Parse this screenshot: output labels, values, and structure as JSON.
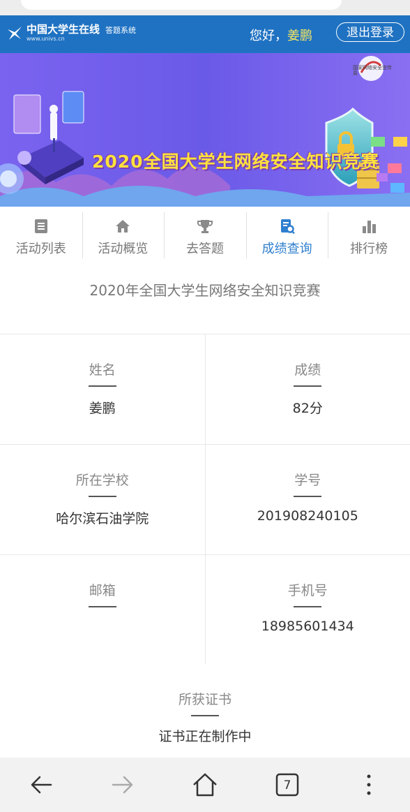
{
  "header": {
    "logo_main": "中国大学生在线",
    "logo_url": "www.univs.cn",
    "logo_sub": "答题系统",
    "greeting": "您好，",
    "username": "姜鹏",
    "logout_label": "退出登录"
  },
  "banner": {
    "title": "2020全国大学生网络安全知识竞赛",
    "org_badge": "国家网络安全宣传周"
  },
  "tabs": [
    {
      "label": "活动列表",
      "icon": "list-icon"
    },
    {
      "label": "活动概览",
      "icon": "home-icon"
    },
    {
      "label": "去答题",
      "icon": "trophy-icon"
    },
    {
      "label": "成绩查询",
      "icon": "score-search-icon",
      "active": true
    },
    {
      "label": "排行榜",
      "icon": "bar-chart-icon"
    }
  ],
  "activity_title": "2020年全国大学生网络安全知识竞赛",
  "info": {
    "name_label": "姓名",
    "name_value": "姜鹏",
    "score_label": "成绩",
    "score_value": "82分",
    "school_label": "所在学校",
    "school_value": "哈尔滨石油学院",
    "student_id_label": "学号",
    "student_id_value": "201908240105",
    "email_label": "邮箱",
    "email_value": "",
    "phone_label": "手机号",
    "phone_value": "18985601434",
    "cert_label": "所获证书",
    "cert_value": "证书正在制作中"
  },
  "browser_nav": {
    "tab_count": "7"
  },
  "colors": {
    "header_blue": "#1f72c2",
    "active_tab": "#2f7fcf",
    "banner_purple": "#6f5ae8",
    "title_yellow": "#ffe23d"
  }
}
